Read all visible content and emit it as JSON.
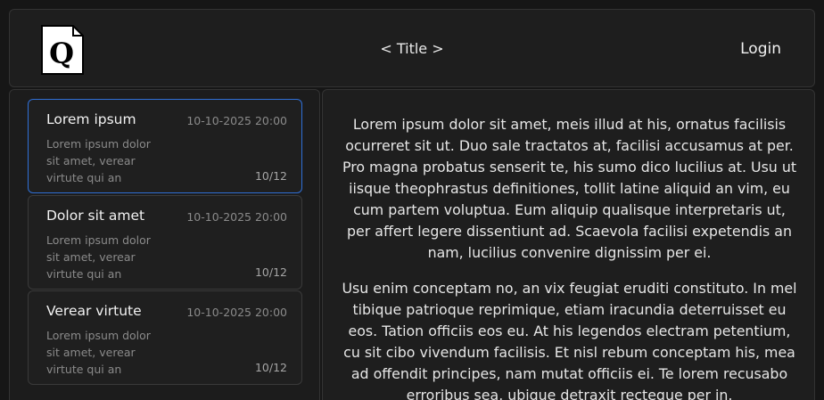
{
  "header": {
    "logo_letter": "Q",
    "title": "< Title >",
    "login_label": "Login"
  },
  "sidebar": {
    "items": [
      {
        "title": "Lorem ipsum",
        "date": "10-10-2025 20:00",
        "snippet": "Lorem ipsum dolor sit amet, verear virtute qui an",
        "count": "10/12",
        "selected": true
      },
      {
        "title": "Dolor sit amet",
        "date": "10-10-2025 20:00",
        "snippet": "Lorem ipsum dolor sit amet, verear virtute qui an",
        "count": "10/12",
        "selected": false
      },
      {
        "title": "Verear virtute",
        "date": "10-10-2025 20:00",
        "snippet": "Lorem ipsum dolor sit amet, verear virtute qui an",
        "count": "10/12",
        "selected": false
      }
    ]
  },
  "content": {
    "paragraphs": [
      "Lorem ipsum dolor sit amet, meis illud at his, ornatus facilisis ocurreret sit ut. Duo sale tractatos at, facilisi accusamus at per. Pro magna probatus senserit te, his sumo dico lucilius at. Usu ut iisque theophrastus definitiones, tollit latine aliquid an vim, eu cum partem voluptua. Eum aliquip qualisque interpretaris ut, per affert legere dissentiunt ad. Scaevola facilisi expetendis an nam, lucilius convenire dignissim per ei.",
      "Usu enim conceptam no, an vix feugiat eruditi constituto. In mel tibique patrioque reprimique, etiam iracundia deterruisset eu eos. Tation officiis eos eu. At his legendos electram petentium, cu sit cibo vivendum facilisis. Et nisl rebum conceptam his, mea ad offendit principes, nam mutat officiis ei. Te lorem recusabo erroribus sea, ubique detraxit recteque per in."
    ]
  },
  "colors": {
    "background": "#161616",
    "panel": "#1e1e1e",
    "accent_selected": "#2f6fd6"
  }
}
